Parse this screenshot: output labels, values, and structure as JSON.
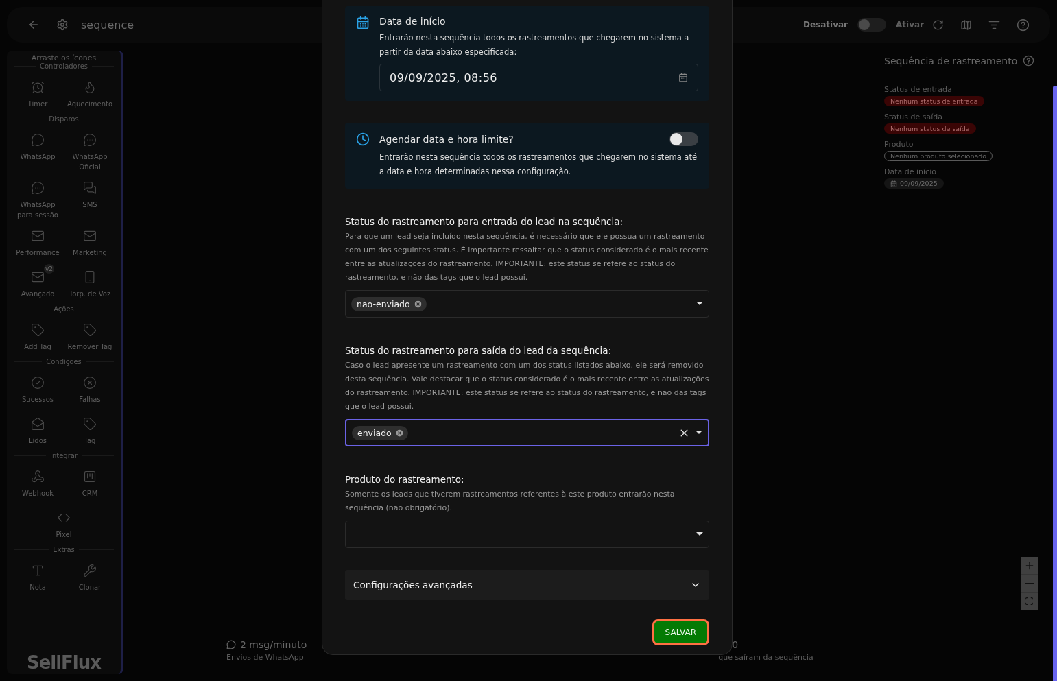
{
  "topbar": {
    "title": "sequence",
    "deactivate_label": "Desativar",
    "activate_label": "Ativar",
    "active": false
  },
  "sidebar": {
    "hint": "Arraste os ícones",
    "sections": [
      {
        "title": "Controladores",
        "items": [
          {
            "kind": "timer",
            "label": "Timer"
          },
          {
            "kind": "flame",
            "label": "Aquecimento"
          }
        ]
      },
      {
        "title": "Disparos",
        "items": [
          {
            "kind": "chat",
            "label": "WhatsApp"
          },
          {
            "kind": "chat-check",
            "label": "WhatsApp Oficial"
          },
          {
            "kind": "chat-check",
            "label": "WhatsApp para sessão"
          },
          {
            "kind": "sms",
            "label": "SMS"
          },
          {
            "kind": "mail",
            "label": "Performance"
          },
          {
            "kind": "mail",
            "label": "Marketing"
          },
          {
            "kind": "mail",
            "label": "Avançado",
            "badge": "v2"
          },
          {
            "kind": "phone",
            "label": "Torp. de Voz"
          }
        ]
      },
      {
        "title": "Ações",
        "items": [
          {
            "kind": "tag",
            "label": "Add Tag"
          },
          {
            "kind": "tag",
            "label": "Remover Tag"
          }
        ]
      },
      {
        "title": "Condições",
        "items": [
          {
            "kind": "check",
            "label": "Sucessos"
          },
          {
            "kind": "x",
            "label": "Falhas"
          },
          {
            "kind": "mail-open",
            "label": "Lidos"
          },
          {
            "kind": "tag",
            "label": "Tag"
          }
        ]
      },
      {
        "title": "Integrar",
        "items": [
          {
            "kind": "webhook",
            "label": "Webhook"
          },
          {
            "kind": "board",
            "label": "CRM"
          },
          {
            "kind": "code",
            "label": "Pixel"
          }
        ]
      },
      {
        "title": "Extras",
        "items": [
          {
            "kind": "text",
            "label": "Nota"
          },
          {
            "kind": "tools",
            "label": "Clonar"
          }
        ]
      }
    ],
    "brand": "SellFlux"
  },
  "stats": [
    {
      "kind": "whatsapp",
      "value": "2 msg/minuto",
      "label": "Envios de WhatsApp"
    },
    {
      "kind": "network",
      "value": "0",
      "label": "que saíram da sequência"
    }
  ],
  "panel": {
    "title": "Sequência de rastreamento",
    "fields": [
      {
        "label": "Status de entrada",
        "value": "Nenhum status de entrada",
        "kind": "danger"
      },
      {
        "label": "Status de saída",
        "value": "Nenhum status de saída",
        "kind": "danger"
      },
      {
        "label": "Produto",
        "value": "Nenhum produto selecionado",
        "kind": "outline"
      },
      {
        "label": "Data de início",
        "value": "09/09/2025",
        "kind": "date"
      }
    ]
  },
  "modal": {
    "start_card": {
      "title": "Data de início",
      "description": "Entrarão nesta sequência todos os rastreamentos que chegarem no sistema a partir da data abaixo especificada:",
      "value": "09/09/2025, 08:56"
    },
    "limit_card": {
      "title": "Agendar data e hora limite?",
      "description": "Entrarão nesta sequência todos os rastreamentos que chegarem no sistema até a data e hora determinadas nessa configuração.",
      "on": false
    },
    "sections": [
      {
        "title": "Status do rastreamento para entrada do lead na sequência:",
        "description": "Para que um lead seja incluído nesta sequência, é necessário que ele possua um rastreamento com um dos seguintes status. É importante ressaltar que o status considerado é o mais recente entre as atualizações do rastreamento. IMPORTANTE: este status se refere ao status do rastreamento, e não das tags que o lead possui.",
        "chips": [
          "nao-enviado"
        ],
        "focused": false
      },
      {
        "title": "Status do rastreamento para saída do lead da sequência:",
        "description": "Caso o lead apresente um rastreamento com um dos status listados abaixo, ele será removido desta sequência. Vale destacar que o status considerado é o mais recente entre as atualizações do rastreamento. IMPORTANTE: este status se refere ao status do rastreamento, e não das tags que o lead possui.",
        "chips": [
          "enviado"
        ],
        "focused": true
      },
      {
        "title": "Produto do rastreamento:",
        "description": "Somente os leads que tiverem rastreamentos referentes à este produto entrarão nesta sequência (não obrigatório).",
        "focused": false
      }
    ],
    "advanced": {
      "label": "Configurações avançadas",
      "expanded": false
    },
    "save": "SALVAR"
  }
}
